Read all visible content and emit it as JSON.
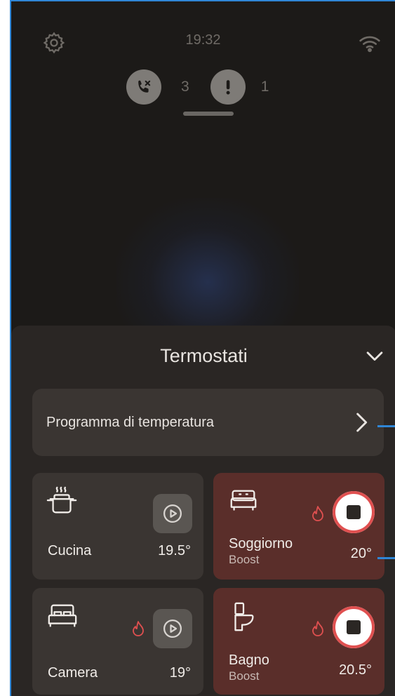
{
  "status_bar": {
    "time": "19:32",
    "settings_icon": "gear-icon",
    "wifi_icon": "wifi-icon"
  },
  "notifications": {
    "missed_calls_icon": "missed-call-icon",
    "missed_calls_count": "3",
    "alerts_icon": "alert-icon",
    "alerts_count": "1"
  },
  "sheet": {
    "title": "Termostati",
    "collapse_icon": "chevron-down-icon",
    "program_label": "Programma di temperatura",
    "program_icon": "chevron-right-icon"
  },
  "thermostats": [
    {
      "name": "Cucina",
      "temperature": "19.5°",
      "mode": "",
      "heating": false,
      "control": "play"
    },
    {
      "name": "Soggiorno",
      "temperature": "20°",
      "mode": "Boost",
      "heating": true,
      "control": "stop"
    },
    {
      "name": "Camera",
      "temperature": "19°",
      "mode": "",
      "heating": true,
      "control": "play"
    },
    {
      "name": "Bagno",
      "temperature": "20.5°",
      "mode": "Boost",
      "heating": true,
      "control": "stop"
    }
  ],
  "colors": {
    "background": "#1c1a18",
    "sheet": "#2a2624",
    "tile_idle": "#3a3532",
    "tile_active": "#5a2e2a",
    "flame": "#e05050",
    "annotation": "#2f86d6"
  }
}
